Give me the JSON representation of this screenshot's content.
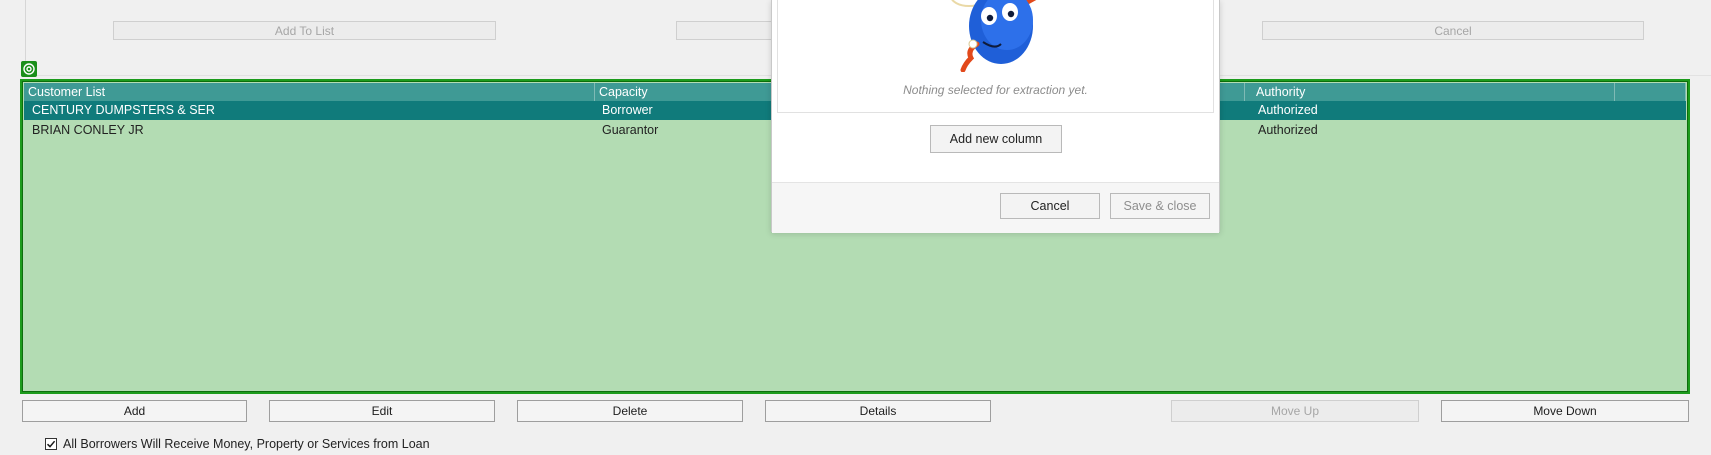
{
  "top_buttons": {
    "add_to_list": "Add To List",
    "cancel": "Cancel"
  },
  "grid": {
    "columns": [
      "Customer List",
      "Capacity",
      "Authority"
    ],
    "rows": [
      {
        "customer": "CENTURY DUMPSTERS & SER",
        "capacity": "Borrower",
        "authority": "Authorized",
        "selected": true
      },
      {
        "customer": "BRIAN CONLEY  JR",
        "capacity": "Guarantor",
        "authority": "Authorized",
        "selected": false
      }
    ]
  },
  "bottom_buttons": {
    "add": "Add",
    "edit": "Edit",
    "delete": "Delete",
    "details": "Details",
    "move_up": "Move Up",
    "move_down": "Move Down"
  },
  "checkbox": {
    "label": "All Borrowers Will Receive Money, Property or Services from Loan",
    "checked": true
  },
  "dialog": {
    "empty_text": "Nothing selected for extraction yet.",
    "add_column": "Add new column",
    "cancel": "Cancel",
    "save_close": "Save & close",
    "illustration": "blue-character-icon"
  },
  "colors": {
    "grid_background": "#b3dcb3",
    "grid_border": "#1c9b1c",
    "header_background": "#3f9a95",
    "selected_row": "#107b7b"
  }
}
